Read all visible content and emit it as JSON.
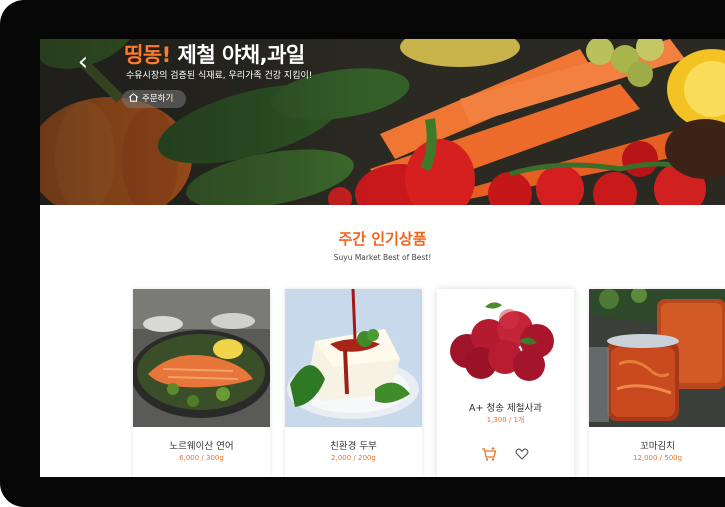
{
  "hero": {
    "title_accent": "띵동!",
    "title_rest": " 제철 야채,과일",
    "subtitle": "수유시장의 검증된 식재료, 우리가족 건강 지킴이!",
    "order_button": "주문하기"
  },
  "section": {
    "title": "주간 인기상품",
    "subtitle": "Suyu Market Best of Best!"
  },
  "products": [
    {
      "name": "노르웨이산 연어",
      "price": "6,000 / 300g"
    },
    {
      "name": "친환경 두부",
      "price": "2,000 / 200g"
    },
    {
      "name": "A+ 청송 제철사과",
      "price": "1,300 / 1개"
    },
    {
      "name": "꼬마김치",
      "price": "12,000 / 500g"
    }
  ],
  "colors": {
    "accent": "#f0641e",
    "price": "#e8742a",
    "device_frame": "#060606"
  },
  "icons": [
    "back-arrow-icon",
    "home-icon",
    "cart-icon",
    "heart-icon"
  ]
}
